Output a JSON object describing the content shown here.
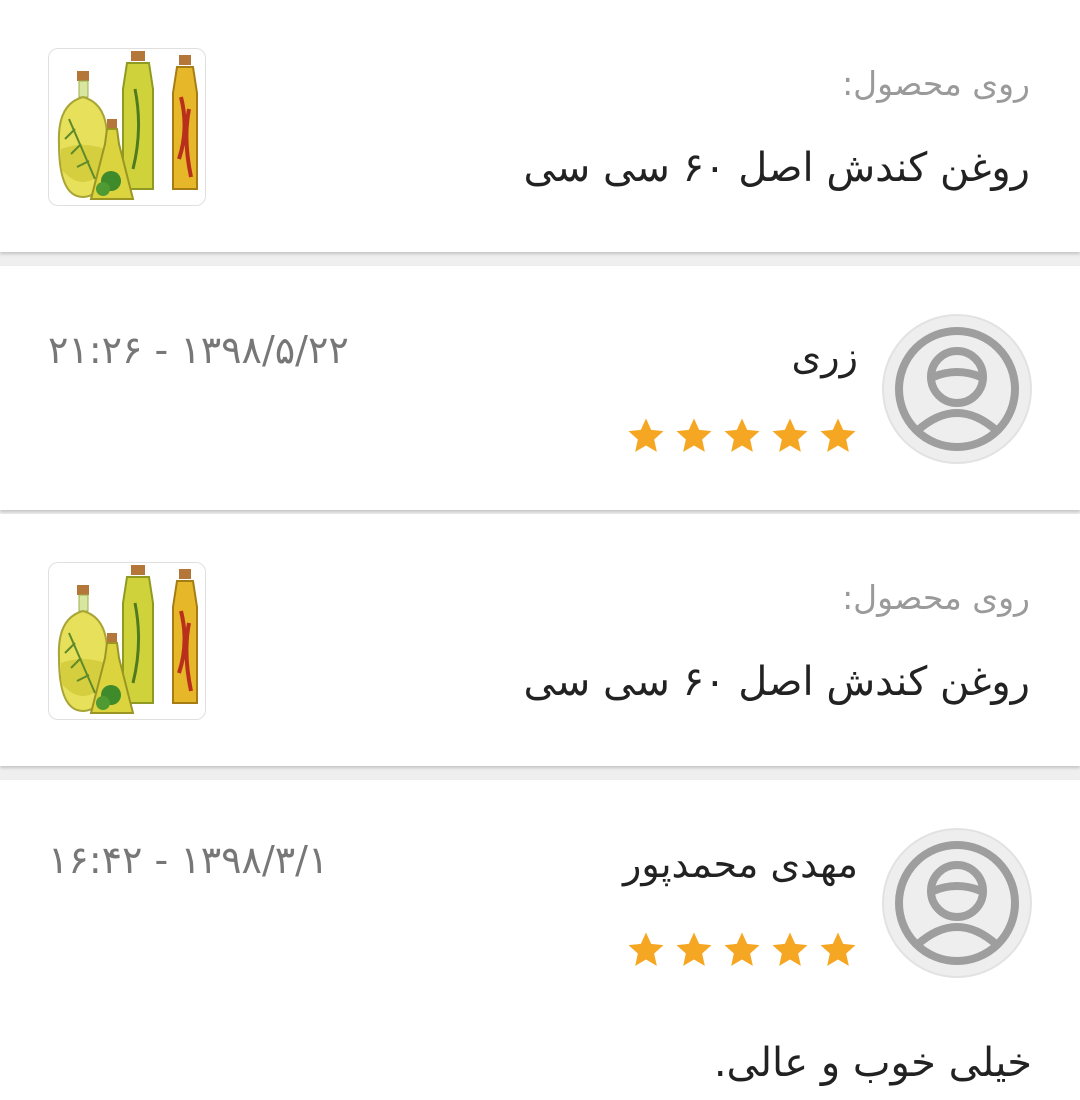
{
  "reviews": [
    {
      "product": {
        "label": "روی محصول:",
        "name": "روغن کندش اصل ۶۰ سی سی",
        "image_icon": "oil-bottles-image"
      },
      "comment": {
        "author": "زری",
        "datetime": "۲۱:۲۶ - ۱۳۹۸/۵/۲۲",
        "rating": 5,
        "avatar_icon": "user-avatar-icon"
      }
    },
    {
      "product": {
        "label": "روی محصول:",
        "name": "روغن کندش اصل ۶۰ سی سی",
        "image_icon": "oil-bottles-image"
      },
      "comment": {
        "author": "مهدی محمدپور",
        "datetime": "۱۶:۴۲ - ۱۳۹۸/۳/۱",
        "rating": 5,
        "avatar_icon": "user-avatar-icon",
        "text": "خیلی خوب و عالی."
      }
    }
  ],
  "colors": {
    "star": "#f5a623",
    "avatar_stroke": "#9e9e9e",
    "muted_text": "#9a9a9a"
  }
}
